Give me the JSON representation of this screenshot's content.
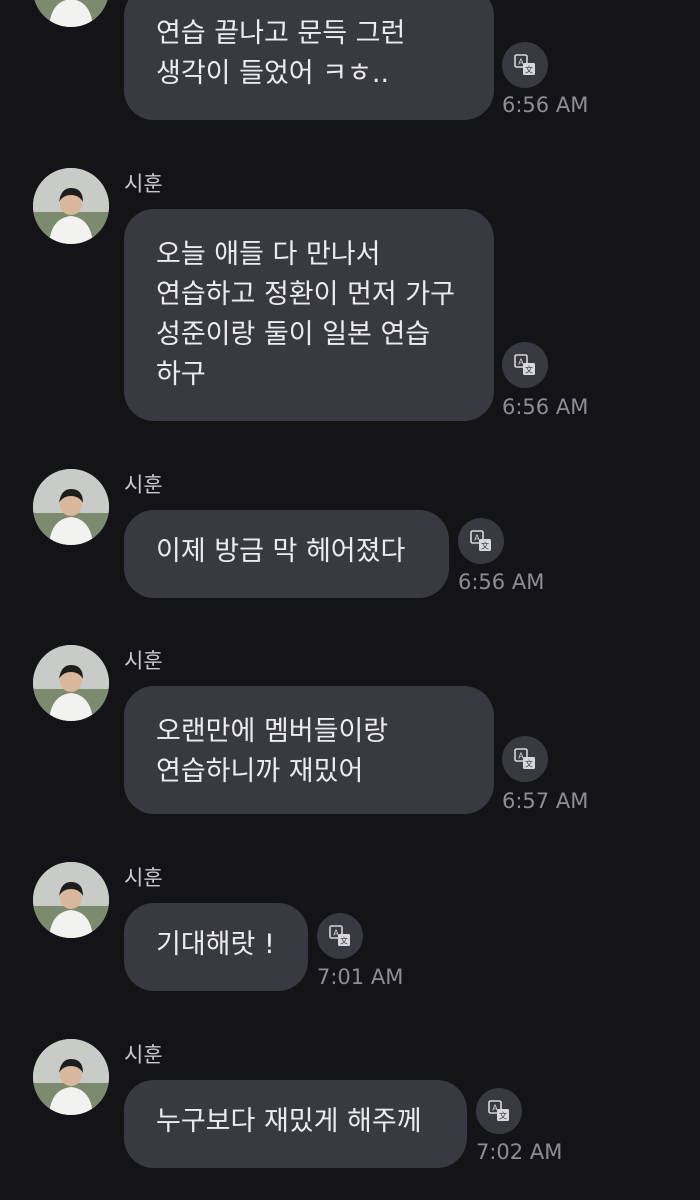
{
  "chat": {
    "messages": [
      {
        "sender": "",
        "text": "연습 끝나고 문득 그런 생각이 들었어 ㅋㅎ..",
        "time": "6:56 AM"
      },
      {
        "sender": "시훈",
        "text": "오늘 애들 다 만나서 연습하고 정환이 먼저 가구 성준이랑 둘이 일본 연습 하구",
        "time": "6:56 AM"
      },
      {
        "sender": "시훈",
        "text": "이제 방금 막 헤어졌다",
        "time": "6:56 AM"
      },
      {
        "sender": "시훈",
        "text": "오랜만에 멤버들이랑 연습하니까 재밌어",
        "time": "6:57 AM"
      },
      {
        "sender": "시훈",
        "text": "기대해랏 !",
        "time": "7:01 AM"
      },
      {
        "sender": "시훈",
        "text": "누구보다 재밌게 해주께",
        "time": "7:02 AM"
      }
    ]
  },
  "icons": {
    "avatar": "avatar-photo",
    "translate": "translate-icon"
  },
  "colors": {
    "background": "#141418",
    "bubble": "#393a41",
    "text": "#ececf0",
    "time": "#8d8d95"
  }
}
